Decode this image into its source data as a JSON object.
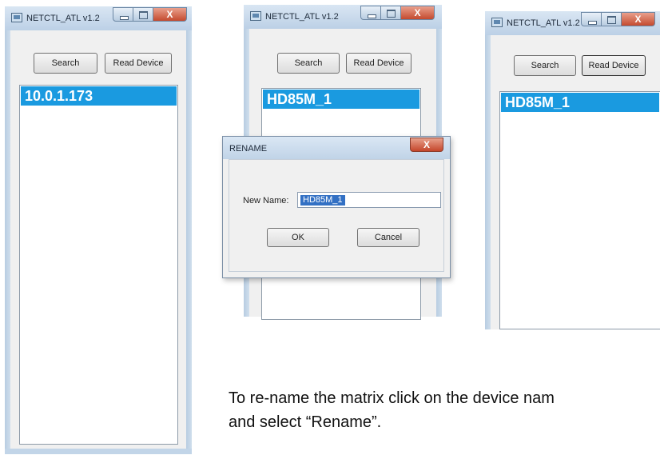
{
  "windows": [
    {
      "title": "NETCTL_ATL v1.2",
      "search_label": "Search",
      "read_device_label": "Read Device",
      "selected_item": "10.0.1.173",
      "close_glyph": "X"
    },
    {
      "title": "NETCTL_ATL v1.2",
      "search_label": "Search",
      "read_device_label": "Read Device",
      "selected_item": "HD85M_1",
      "close_glyph": "X"
    },
    {
      "title": "NETCTL_ATL v1.2",
      "search_label": "Search",
      "read_device_label": "Read Device",
      "selected_item": "HD85M_1",
      "close_glyph": "X"
    }
  ],
  "rename_dialog": {
    "title": "RENAME",
    "close_glyph": "X",
    "label": "New Name:",
    "value": "HD85M_1",
    "ok_label": "OK",
    "cancel_label": "Cancel"
  },
  "caption": {
    "line1": "To re-name the matrix click on the device nam",
    "line2": "and select “Rename”."
  },
  "colors": {
    "selection": "#1a9ae0",
    "close_button": "#c4462b",
    "titlebar": "#bcd0e6"
  }
}
